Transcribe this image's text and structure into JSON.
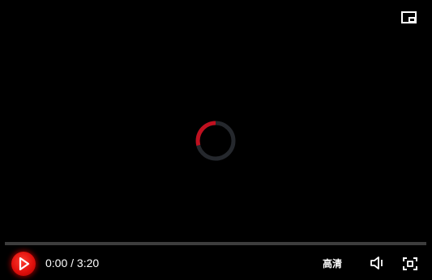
{
  "player": {
    "current_time": "0:00",
    "separator": "/",
    "duration": "3:20",
    "progress_fraction": 0,
    "quality_label": "高清",
    "loading": true
  },
  "icons": {
    "top_right": "picture-in-picture-icon",
    "center": "loading-spinner-icon",
    "play": "play-icon",
    "volume": "volume-icon",
    "fullscreen": "fullscreen-icon"
  },
  "colors": {
    "background": "#000000",
    "accent": "#d0021b",
    "play_button": "#e0100c",
    "progress_track": "#3d3d3d",
    "spinner_track": "#25282d",
    "text": "#ffffff"
  }
}
